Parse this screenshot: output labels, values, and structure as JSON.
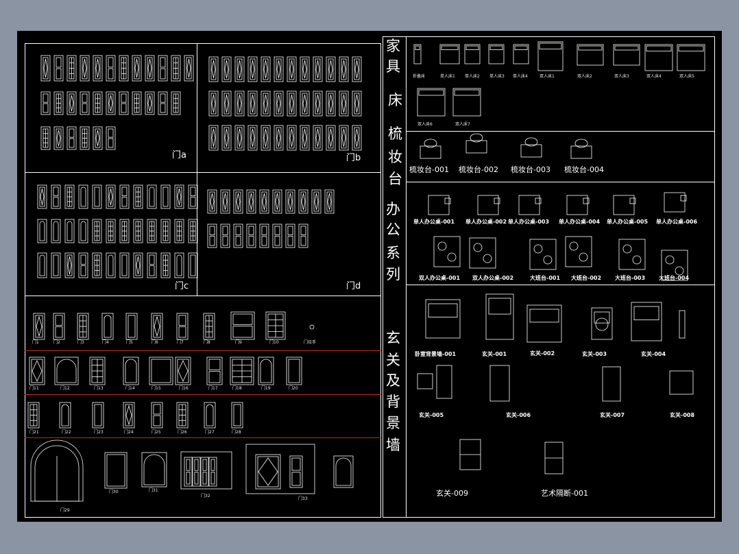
{
  "colors": {
    "background": "#8a94a3",
    "sheet": "#000000",
    "line": "#ffffff",
    "separator": "#c0282d"
  },
  "left": {
    "panel_labels": {
      "a": "门a",
      "b": "门b",
      "c": "门c",
      "d": "门d"
    },
    "door_rows": [
      [
        "门1",
        "门2",
        "门3",
        "门4",
        "门5",
        "门6",
        "门7",
        "门8",
        "门9",
        "门10",
        "门拉手"
      ],
      [
        "门11",
        "门12",
        "门13",
        "门14",
        "门15",
        "门16",
        "门17",
        "门18",
        "门19",
        "门20"
      ],
      [
        "门21",
        "门22",
        "门23",
        "门24",
        "门25",
        "门26",
        "门27",
        "门28"
      ],
      [
        "门29",
        "门30",
        "门31",
        "门32",
        "门33"
      ]
    ]
  },
  "right": {
    "vertical_titles": {
      "furniture": [
        "家",
        "具"
      ],
      "bed": [
        "床"
      ],
      "dresser": [
        "梳",
        "妆",
        "台"
      ],
      "office": [
        "办",
        "公",
        "系",
        "列"
      ],
      "entrance": [
        "玄",
        "关",
        "及",
        "背",
        "景",
        "墙"
      ]
    },
    "beds": [
      "折叠床",
      "单人床1",
      "单人床2",
      "单人床3",
      "单人床4",
      "双人床1",
      "双人床2",
      "双人床3",
      "双人床4",
      "双人床5",
      "双人床6",
      "双人床7"
    ],
    "dressers": [
      "梳妆台-001",
      "梳妆台-002",
      "梳妆台-003",
      "梳妆台-004"
    ],
    "office_row1": [
      "单人办公桌-001",
      "单人办公桌-002",
      "单人办公桌-003",
      "单人办公桌-004",
      "单人办公桌-005",
      "单人办公桌-006"
    ],
    "office_row2": [
      "双人办公桌-001",
      "双人办公桌-002",
      "大班台-001",
      "大班台-002",
      "大班台-003",
      "大班台-004"
    ],
    "entrance_row1": [
      "卧室背景墙-001",
      "玄关-001",
      "玄关-002",
      "玄关-003",
      "玄关-004"
    ],
    "entrance_row2": [
      "玄关-005",
      "玄关-006",
      "玄关-007",
      "玄关-008"
    ],
    "entrance_row3": [
      "玄关-009",
      "艺术隔断-001"
    ]
  }
}
